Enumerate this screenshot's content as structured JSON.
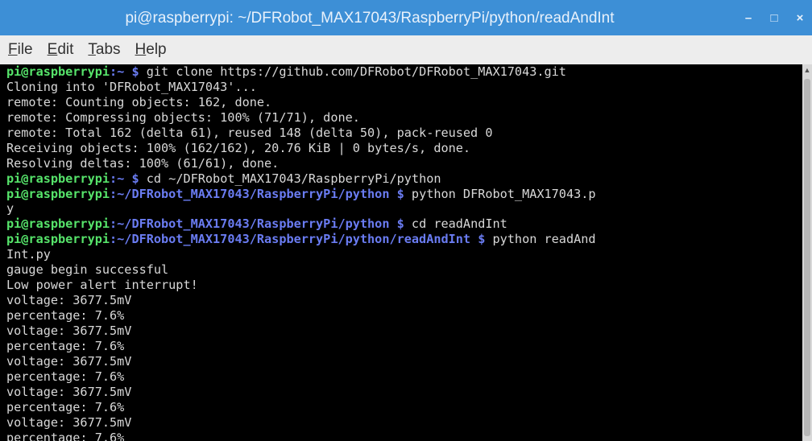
{
  "window": {
    "title": "pi@raspberrypi: ~/DFRobot_MAX17043/RaspberryPi/python/readAndInt",
    "controls": {
      "minimize": "–",
      "maximize": "□",
      "close": "×"
    }
  },
  "menu": [
    {
      "acc": "F",
      "rest": "ile"
    },
    {
      "acc": "E",
      "rest": "dit"
    },
    {
      "acc": "T",
      "rest": "abs"
    },
    {
      "acc": "H",
      "rest": "elp"
    }
  ],
  "colors": {
    "titlebar": "#3d8fd6",
    "prompt_user": "#56e36a",
    "prompt_path": "#6a7cf2",
    "text": "#d8d8d8"
  },
  "terminal": {
    "lines": [
      {
        "user": "pi@raspberrypi",
        "path": ":~",
        "dollar": " $",
        "text": " git clone https://github.com/DFRobot/DFRobot_MAX17043.git"
      },
      {
        "text": "Cloning into 'DFRobot_MAX17043'..."
      },
      {
        "text": "remote: Counting objects: 162, done."
      },
      {
        "text": "remote: Compressing objects: 100% (71/71), done."
      },
      {
        "text": "remote: Total 162 (delta 61), reused 148 (delta 50), pack-reused 0"
      },
      {
        "text": "Receiving objects: 100% (162/162), 20.76 KiB | 0 bytes/s, done."
      },
      {
        "text": "Resolving deltas: 100% (61/61), done."
      },
      {
        "user": "pi@raspberrypi",
        "path": ":~",
        "dollar": " $",
        "text": " cd ~/DFRobot_MAX17043/RaspberryPi/python"
      },
      {
        "user": "pi@raspberrypi",
        "path": ":~/DFRobot_MAX17043/RaspberryPi/python",
        "dollar": " $",
        "text": " python DFRobot_MAX17043.p"
      },
      {
        "text": "y"
      },
      {
        "user": "pi@raspberrypi",
        "path": ":~/DFRobot_MAX17043/RaspberryPi/python",
        "dollar": " $",
        "text": " cd readAndInt"
      },
      {
        "user": "pi@raspberrypi",
        "path": ":~/DFRobot_MAX17043/RaspberryPi/python/readAndInt",
        "dollar": " $",
        "text": " python readAnd"
      },
      {
        "text": "Int.py"
      },
      {
        "text": "gauge begin successful"
      },
      {
        "text": "Low power alert interrupt!"
      },
      {
        "text": "voltage: 3677.5mV"
      },
      {
        "text": "percentage: 7.6%"
      },
      {
        "text": "voltage: 3677.5mV"
      },
      {
        "text": "percentage: 7.6%"
      },
      {
        "text": "voltage: 3677.5mV"
      },
      {
        "text": "percentage: 7.6%"
      },
      {
        "text": "voltage: 3677.5mV"
      },
      {
        "text": "percentage: 7.6%"
      },
      {
        "text": "voltage: 3677.5mV"
      },
      {
        "text": "percentage: 7.6%"
      }
    ]
  }
}
